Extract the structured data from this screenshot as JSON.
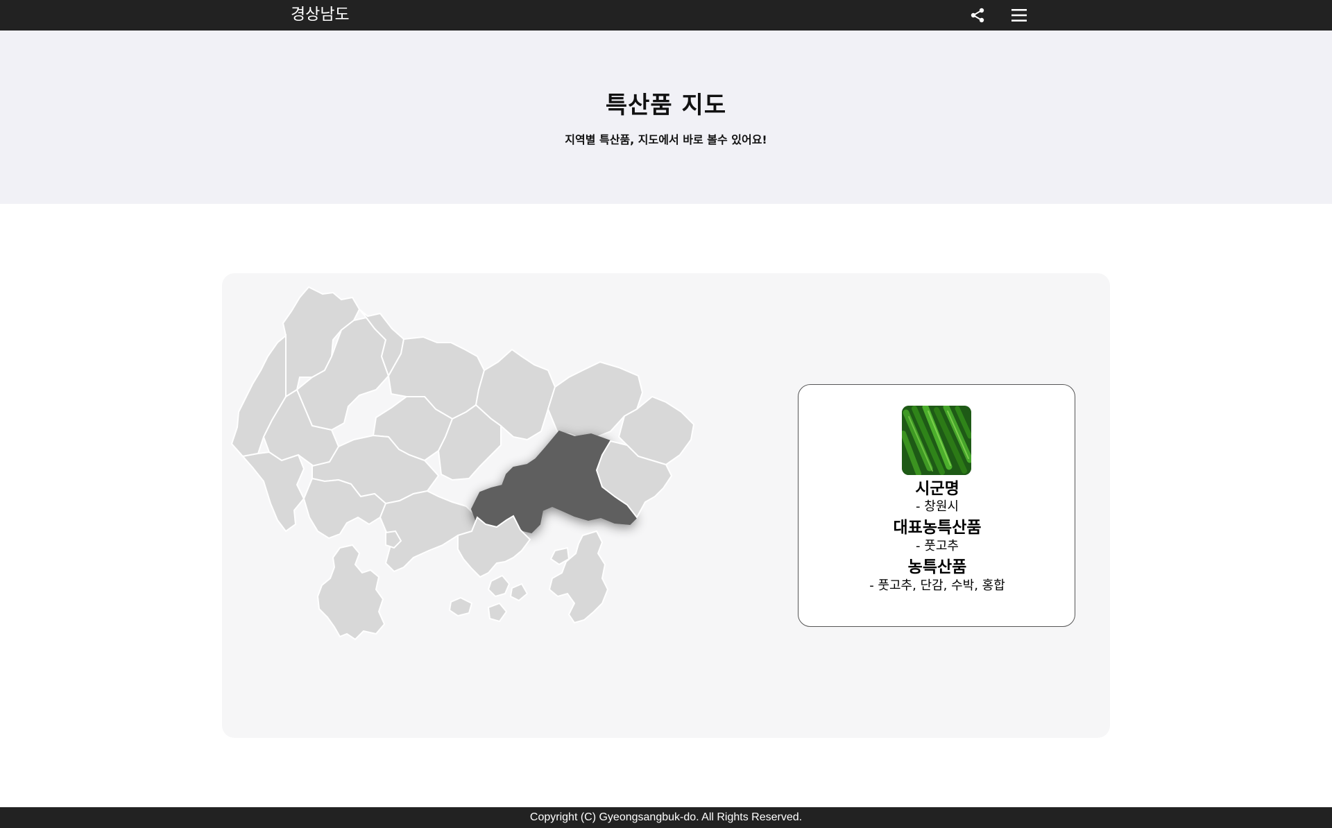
{
  "header": {
    "title": "경상남도",
    "share_icon": "share-icon",
    "menu_icon": "hamburger-menu-icon"
  },
  "hero": {
    "title": "특산품 지도",
    "subtitle": "지역별 특산품, 지도에서 바로 볼수 있어요!"
  },
  "map": {
    "selected_region": "창원시",
    "region_color": "#d8d8d8",
    "selected_color": "#5f5f5f"
  },
  "info_card": {
    "image_icon": "green-pepper-image",
    "city_label": "시군명",
    "city_value": "- 창원시",
    "main_product_label": "대표농특산품",
    "main_product_value": "- 풋고추",
    "products_label": "농특산품",
    "products_value": "- 풋고추, 단감, 수박, 홍합"
  },
  "footer": {
    "copyright": "Copyright (C) Gyeongsangbuk-do. All Rights Reserved."
  }
}
